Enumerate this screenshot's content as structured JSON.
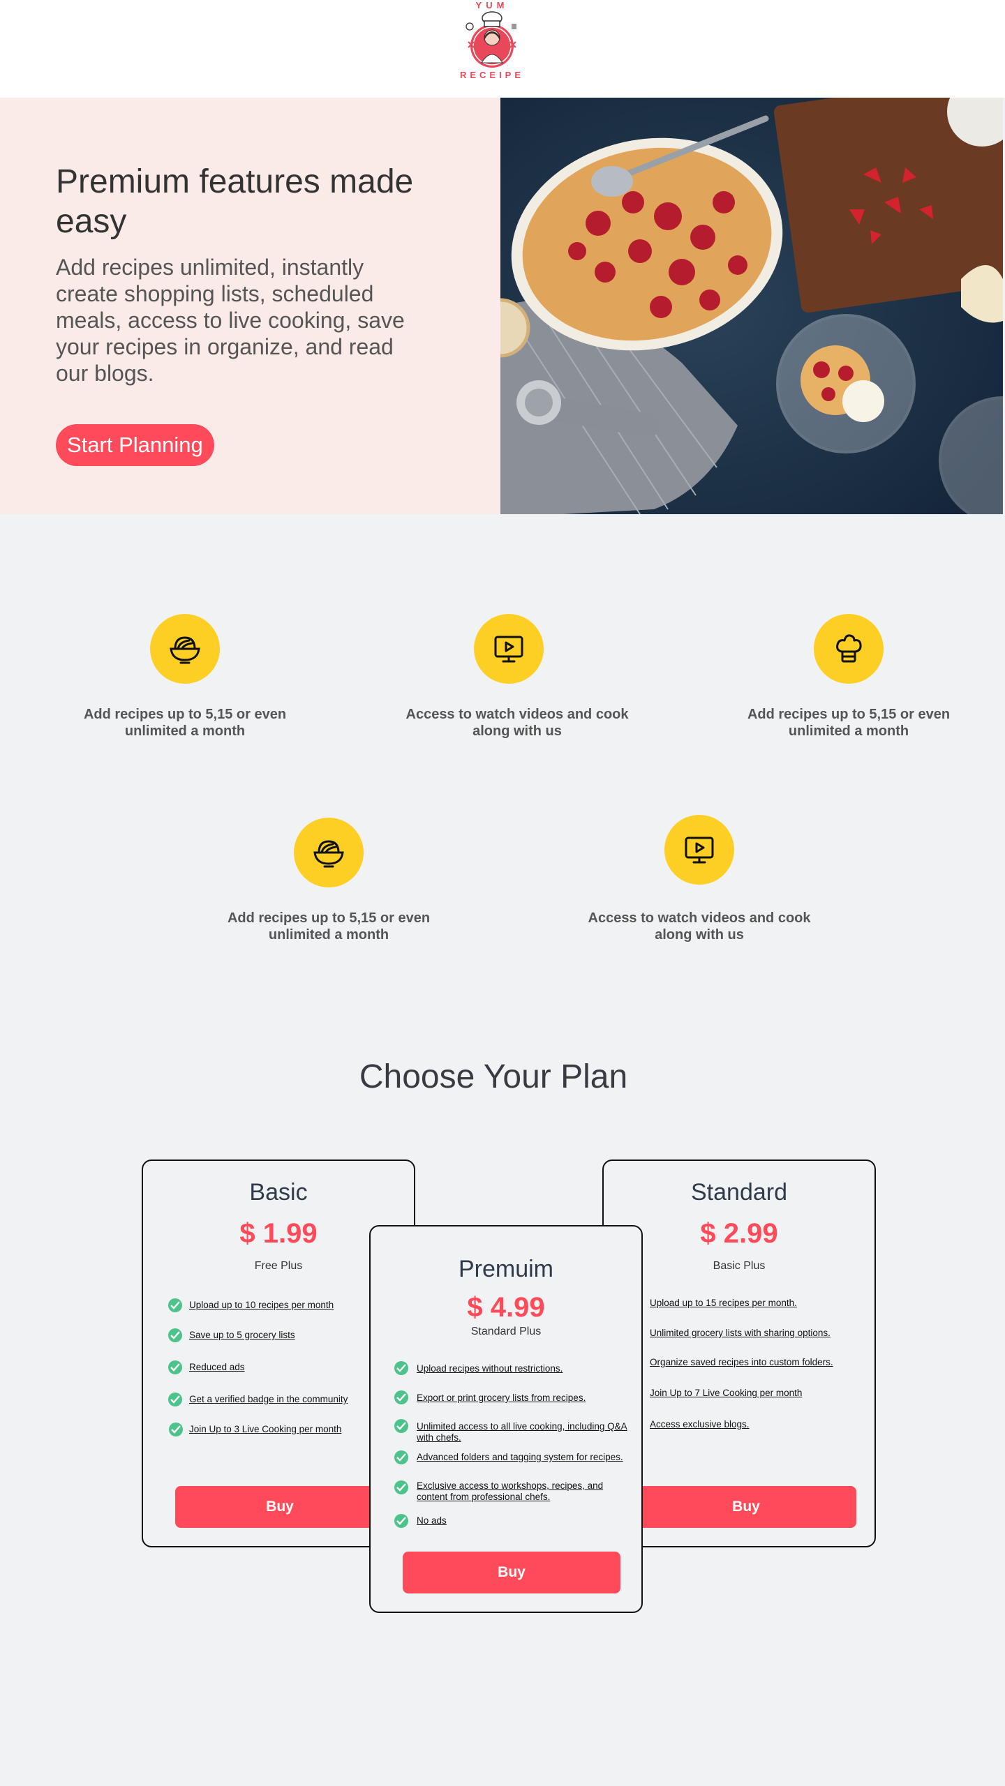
{
  "brand": {
    "logo_top": "YUM",
    "logo_bottom": "RECEIPE"
  },
  "hero": {
    "title": "Premium features made easy",
    "description": "Add recipes unlimited, instantly create shopping lists, scheduled meals, access to live cooking, save your recipes in organize, and read our blogs.",
    "button_label": "Start Planning"
  },
  "features": [
    {
      "icon": "bowl-icon",
      "text": "Add recipes  up to 5,15 or even unlimited a month"
    },
    {
      "icon": "tv-play-icon",
      "text": "Access to watch videos and cook along with us"
    },
    {
      "icon": "chef-hat-icon",
      "text": "Add recipes  up to 5,15 or even unlimited a month"
    },
    {
      "icon": "bowl-icon",
      "text": "Add recipes  up to 5,15 or even unlimited a month"
    },
    {
      "icon": "tv-play-icon",
      "text": "Access to watch videos and cook along with us"
    }
  ],
  "plans_title": "Choose Your Plan",
  "plans": {
    "basic": {
      "name": "Basic",
      "price": "$ 1.99",
      "subtitle": "Free Plus",
      "features": [
        "Upload up to 10 recipes per month",
        "Save up to 5 grocery lists",
        "Reduced ads",
        "Get a verified badge in the community",
        "Join Up to 3 Live Cooking per month"
      ],
      "button_label": "Buy"
    },
    "premium": {
      "name": "Premuim",
      "price": "$ 4.99",
      "subtitle": "Standard Plus",
      "features": [
        "Upload recipes without restrictions.",
        "Export or print grocery lists from recipes.",
        "Unlimited access to all live cooking, including Q&A with chefs.",
        "Advanced folders and tagging system for recipes.",
        "Exclusive access to workshops, recipes, and content from professional chefs.",
        "No ads"
      ],
      "button_label": "Buy"
    },
    "standard": {
      "name": "Standard",
      "price": "$ 2.99",
      "subtitle": "Basic Plus",
      "features": [
        "Upload up to 15 recipes per month.",
        "Unlimited grocery lists with sharing options.",
        "Organize saved recipes into custom folders.",
        "Join Up to 7 Live Cooking per month",
        "Access exclusive blogs."
      ],
      "button_label": "Buy"
    }
  },
  "colors": {
    "accent": "#ff4a59",
    "icon_bg": "#fdcf24",
    "hero_bg": "#fbebe8",
    "check": "#4cc38a"
  }
}
